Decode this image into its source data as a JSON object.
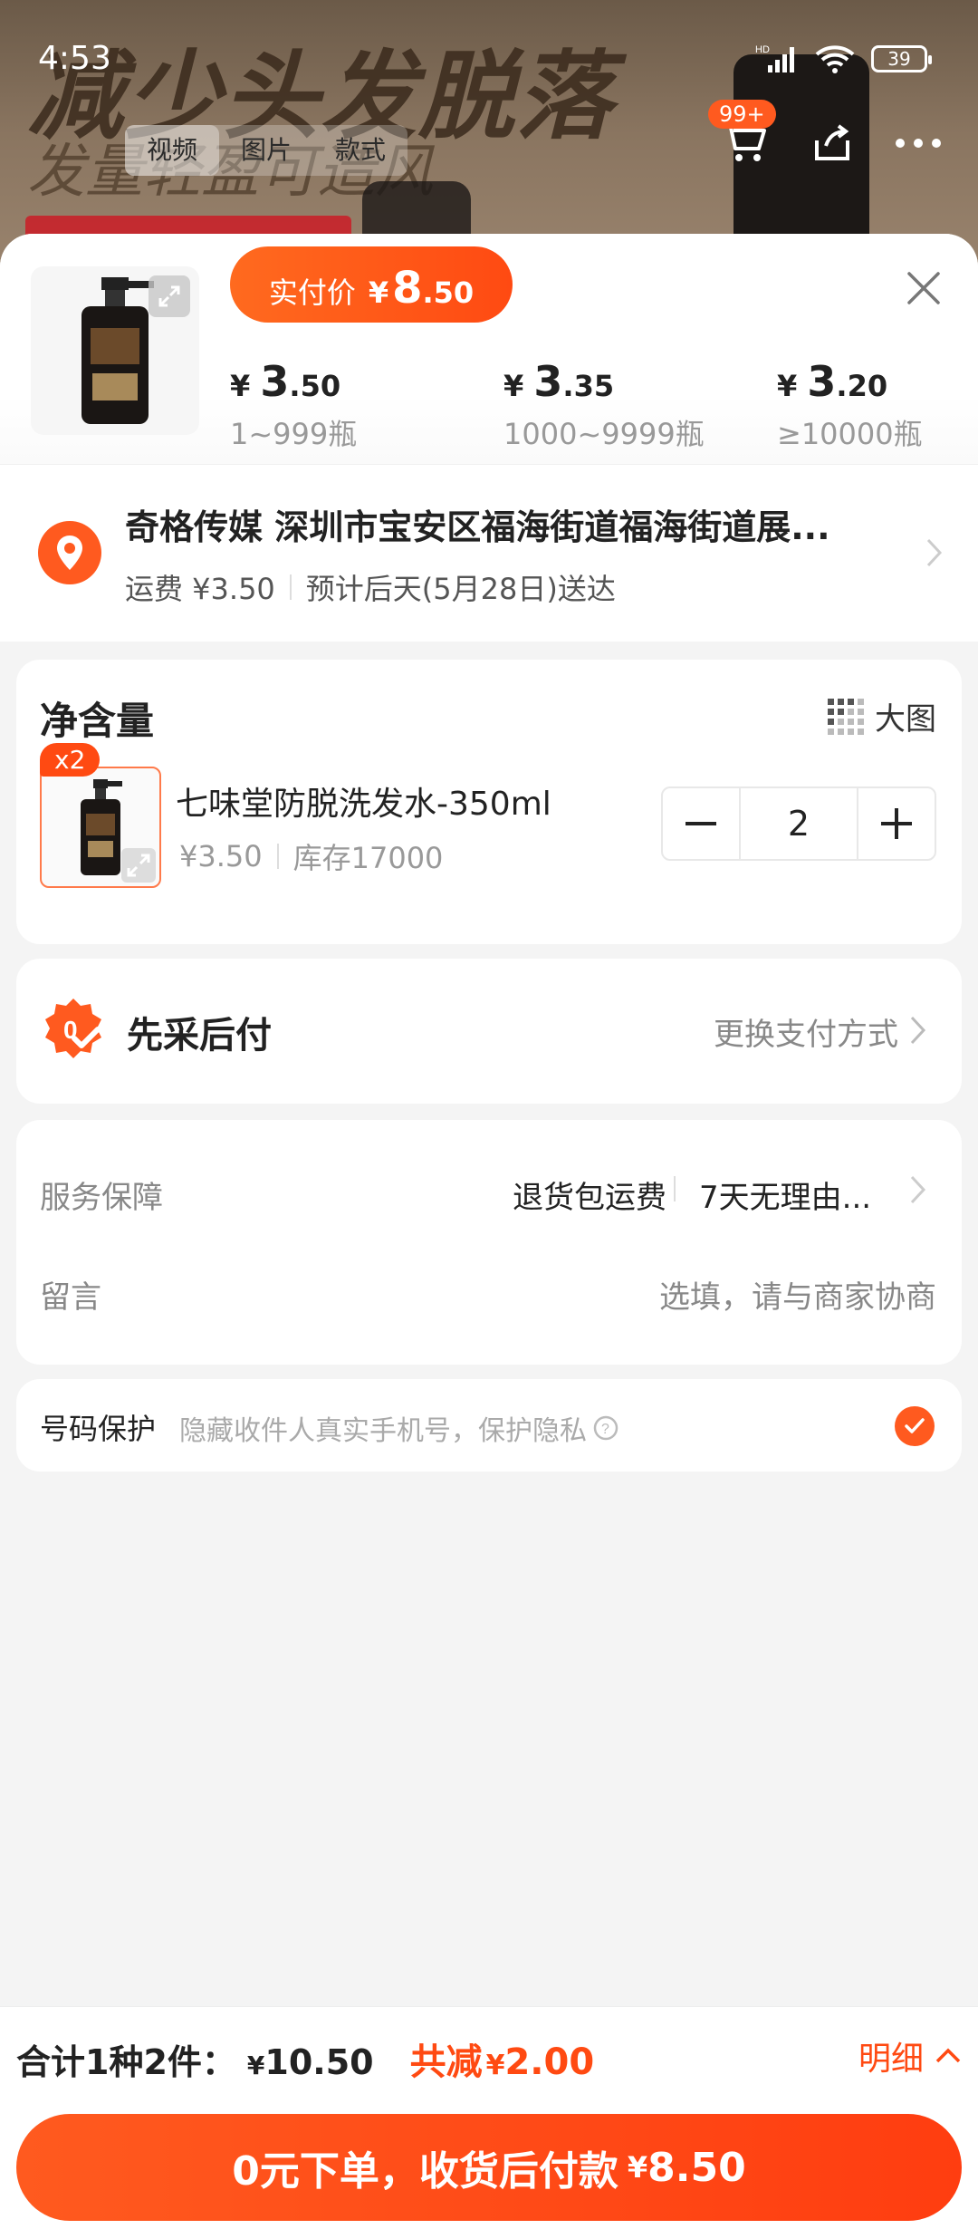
{
  "status": {
    "time": "4:53",
    "battery": "39",
    "network": "HD"
  },
  "background": {
    "headline": "减少头发脱落",
    "subline": "发量轻盈可造风",
    "tabs": [
      "视频",
      "图片",
      "款式"
    ],
    "cart_badge": "99+"
  },
  "sheet": {
    "pay_pill": {
      "label": "实付价",
      "currency": "¥",
      "int": "8",
      "dec": ".50"
    },
    "tiers": [
      {
        "currency": "¥",
        "int": "3",
        "dec": ".50",
        "qty": "1~999瓶"
      },
      {
        "currency": "¥",
        "int": "3",
        "dec": ".35",
        "qty": "1000~9999瓶"
      },
      {
        "currency": "¥",
        "int": "3",
        "dec": ".20",
        "qty": "≥10000瓶"
      }
    ]
  },
  "address": {
    "title": "奇格传媒 深圳市宝安区福海街道福海街道展...",
    "shipping": "运费 ¥3.50",
    "eta": "预计后天(5月28日)送达"
  },
  "variant": {
    "section_title": "净含量",
    "big_image_label": "大图",
    "badge": "x2",
    "name": "七味堂防脱洗发水-350ml",
    "price": "¥3.50",
    "stock": "库存17000",
    "quantity": "2"
  },
  "payment": {
    "label": "先采后付",
    "change": "更换支付方式"
  },
  "service": {
    "label": "服务保障",
    "value1": "退货包运费",
    "value2": "7天无理由...",
    "message_label": "留言",
    "message_placeholder": "选填，请与商家协商"
  },
  "privacy": {
    "label": "号码保护",
    "desc": "隐藏收件人真实手机号，保护隐私"
  },
  "footer": {
    "summary": "合计1种2件：",
    "currency": "¥",
    "total": "10.50",
    "save_label": "共减",
    "save_amount": "2.00",
    "detail": "明细",
    "order_text": "0元下单，收货后付款",
    "order_amount": "8.50"
  },
  "colors": {
    "accent": "#ff4a12",
    "accent_light": "#ff6a1f"
  }
}
